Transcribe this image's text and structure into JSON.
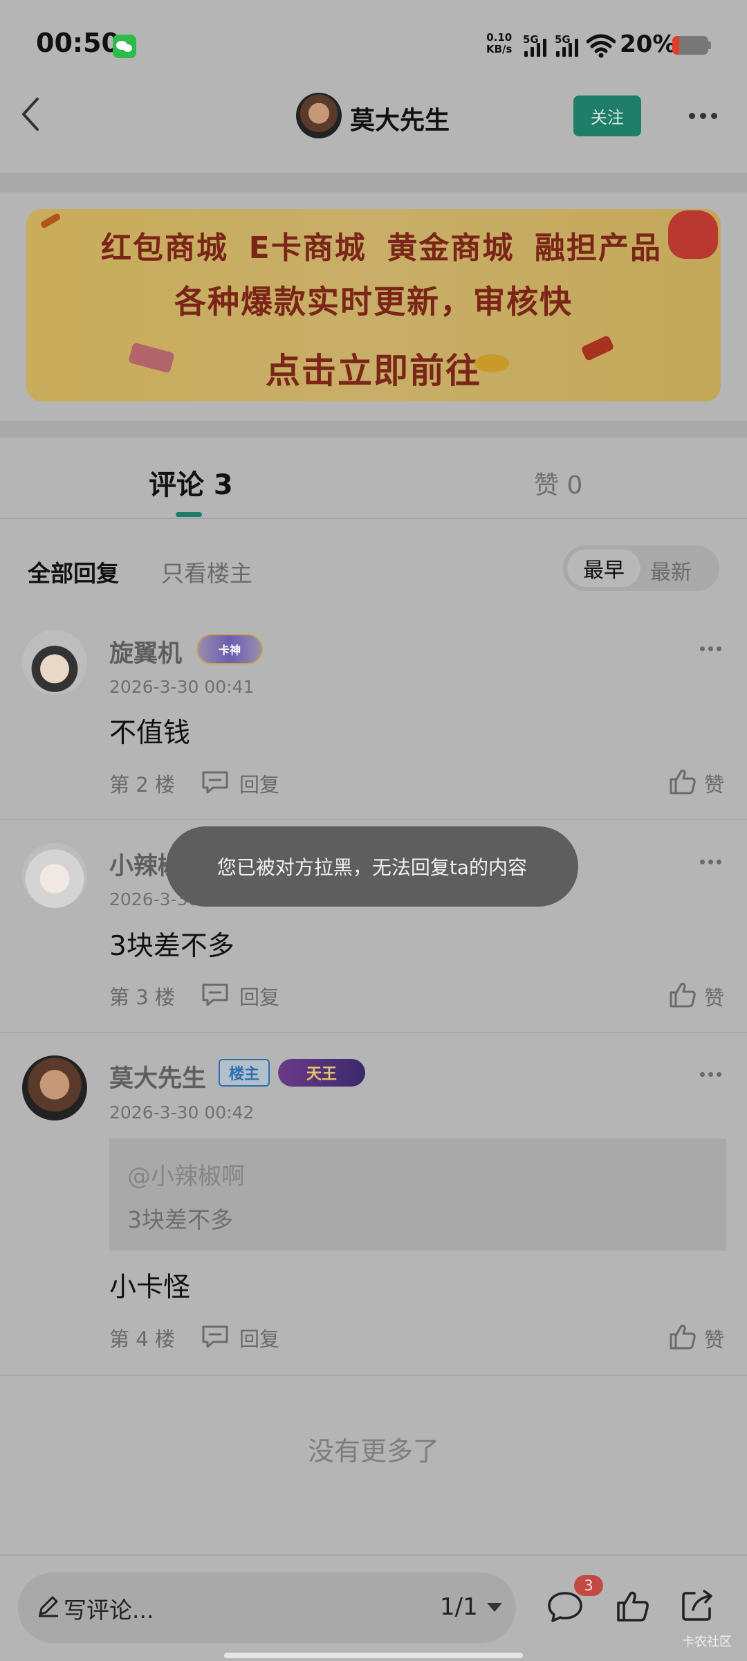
{
  "status_bar": {
    "time": "00:50",
    "net_speed_value": "0.10",
    "net_speed_unit": "KB/s",
    "sim1": "5G",
    "sim2": "5G",
    "battery": "20%",
    "battery_level": 0.2,
    "app_icon": "wechat-icon"
  },
  "header": {
    "title": "莫大先生",
    "follow_label": "关注"
  },
  "banner": {
    "items": [
      "红包商城",
      "E卡商城",
      "黄金商城",
      "融担产品"
    ],
    "line2": "各种爆款实时更新，审核快",
    "line3": "点击立即前往"
  },
  "tabs": {
    "comments": "评论 3",
    "likes": "赞 0"
  },
  "filters": {
    "all": "全部回复",
    "owner_only": "只看楼主",
    "sort_earliest": "最早",
    "sort_newest": "最新"
  },
  "comments": [
    {
      "username": "旋翼机",
      "badge": "卡神",
      "time": "2026-3-30 00:41",
      "content": "不值钱",
      "floor": "第 2 楼",
      "reply": "回复",
      "like": "赞"
    },
    {
      "username": "小辣椒啊",
      "time": "2026-3-30 00:41",
      "content": "3块差不多",
      "floor": "第 3 楼",
      "reply": "回复",
      "like": "赞"
    },
    {
      "username": "莫大先生",
      "owner_badge": "楼主",
      "badge": "天王",
      "time": "2026-3-30 00:42",
      "quote_user": "@小辣椒啊",
      "quote_text": "3块差不多",
      "content": "小卡怪",
      "floor": "第 4 楼",
      "reply": "回复",
      "like": "赞"
    }
  ],
  "no_more": "没有更多了",
  "toast": "您已被对方拉黑，无法回复ta的内容",
  "bottom_bar": {
    "write_placeholder": "写评论...",
    "page": "1/1",
    "comment_count": "3"
  },
  "watermark": "卡农社区",
  "colors": {
    "accent": "#1f7e67",
    "badge_red": "#c24a43",
    "owner_blue": "#2e6fb0"
  }
}
